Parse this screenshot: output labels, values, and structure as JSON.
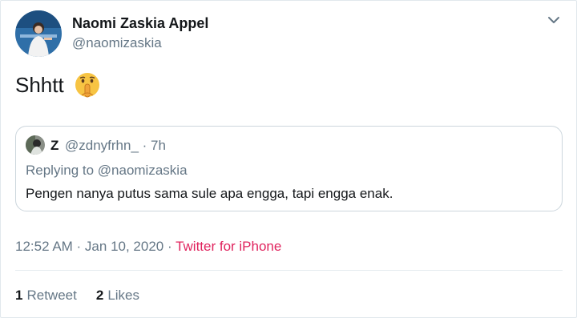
{
  "tweet": {
    "display_name": "Naomi Zaskia Appel",
    "handle": "@naomizaskia",
    "text": "Shhtt",
    "emoji_icon": "shushing-face-icon",
    "timestamp": "12:52 AM · Jan 10, 2020",
    "separator": " · ",
    "source": "Twitter for iPhone",
    "source_color": "#e0245e"
  },
  "quote": {
    "name": "Z",
    "meta": "@zdnyfrhn_ · 7h",
    "replying": "Replying to @naomizaskia",
    "text": "Pengen nanya putus sama sule apa engga, tapi engga enak."
  },
  "stats": {
    "retweets_count": "1",
    "retweets_label": "Retweet",
    "likes_count": "2",
    "likes_label": "Likes"
  },
  "colors": {
    "text_primary": "#14171a",
    "text_secondary": "#657786",
    "border": "#ccd6dd",
    "accent": "#e0245e"
  }
}
